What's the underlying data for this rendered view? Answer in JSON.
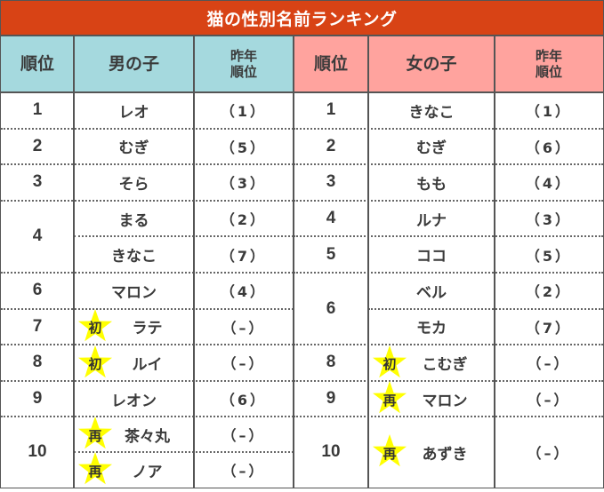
{
  "title": "猫の性別名前ランキング",
  "boys": {
    "headers": {
      "rank": "順位",
      "name": "男の子",
      "prev": "昨年\n順位"
    },
    "color": "#a5d9de",
    "rows": [
      {
        "rank": "1",
        "entries": [
          {
            "name": "レオ",
            "prev": "（1）",
            "badge": ""
          }
        ]
      },
      {
        "rank": "2",
        "entries": [
          {
            "name": "むぎ",
            "prev": "（5）",
            "badge": ""
          }
        ]
      },
      {
        "rank": "3",
        "entries": [
          {
            "name": "そら",
            "prev": "（3）",
            "badge": ""
          }
        ]
      },
      {
        "rank": "4",
        "entries": [
          {
            "name": "まる",
            "prev": "（2）",
            "badge": ""
          },
          {
            "name": "きなこ",
            "prev": "（7）",
            "badge": ""
          }
        ]
      },
      {
        "rank": "6",
        "entries": [
          {
            "name": "マロン",
            "prev": "（4）",
            "badge": ""
          }
        ]
      },
      {
        "rank": "7",
        "entries": [
          {
            "name": "ラテ",
            "prev": "（–）",
            "badge": "初"
          }
        ]
      },
      {
        "rank": "8",
        "entries": [
          {
            "name": "ルイ",
            "prev": "（–）",
            "badge": "初"
          }
        ]
      },
      {
        "rank": "9",
        "entries": [
          {
            "name": "レオン",
            "prev": "（6）",
            "badge": ""
          }
        ]
      },
      {
        "rank": "10",
        "entries": [
          {
            "name": "茶々丸",
            "prev": "（–）",
            "badge": "再"
          },
          {
            "name": "ノア",
            "prev": "（–）",
            "badge": "再"
          }
        ]
      }
    ]
  },
  "girls": {
    "headers": {
      "rank": "順位",
      "name": "女の子",
      "prev": "昨年\n順位"
    },
    "color": "#ffa39e",
    "rows": [
      {
        "rank": "1",
        "entries": [
          {
            "name": "きなこ",
            "prev": "（1）",
            "badge": ""
          }
        ]
      },
      {
        "rank": "2",
        "entries": [
          {
            "name": "むぎ",
            "prev": "（6）",
            "badge": ""
          }
        ]
      },
      {
        "rank": "3",
        "entries": [
          {
            "name": "もも",
            "prev": "（4）",
            "badge": ""
          }
        ]
      },
      {
        "rank": "4",
        "entries": [
          {
            "name": "ルナ",
            "prev": "（3）",
            "badge": ""
          }
        ]
      },
      {
        "rank": "5",
        "entries": [
          {
            "name": "ココ",
            "prev": "（5）",
            "badge": ""
          }
        ]
      },
      {
        "rank": "6",
        "entries": [
          {
            "name": "ベル",
            "prev": "（2）",
            "badge": ""
          },
          {
            "name": "モカ",
            "prev": "（7）",
            "badge": ""
          }
        ]
      },
      {
        "rank": "8",
        "entries": [
          {
            "name": "こむぎ",
            "prev": "（–）",
            "badge": "初"
          }
        ]
      },
      {
        "rank": "9",
        "entries": [
          {
            "name": "マロン",
            "prev": "（–）",
            "badge": "再"
          }
        ]
      },
      {
        "rank": "10",
        "entries": [
          {
            "name": "あずき",
            "prev": "（–）",
            "badge": "再"
          }
        ],
        "tall": true
      }
    ]
  },
  "colors": {
    "title_bg": "#d84315",
    "star": "#ffff00"
  },
  "legend_badges": {
    "first_time": "初",
    "returning": "再"
  }
}
